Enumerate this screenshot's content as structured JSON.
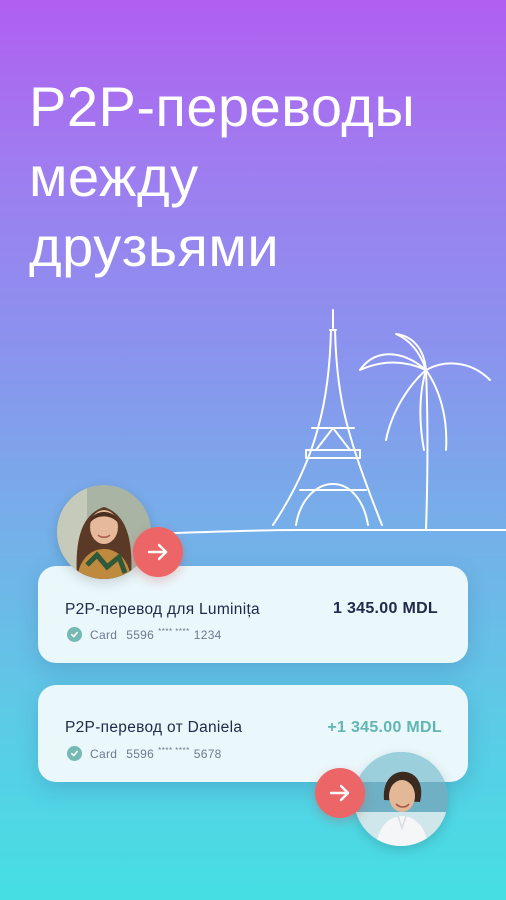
{
  "headline": {
    "line1": "P2P-переводы",
    "line2": "между",
    "line3": "друзьями"
  },
  "colors": {
    "gradient_top": "#b05ff0",
    "gradient_bottom": "#45dfe3",
    "card_background": "#eaf7fb",
    "arrow_button": "#ec6567",
    "incoming_amount": "#5fb6b2",
    "check": "#74b9b3"
  },
  "transfers": [
    {
      "title": "P2P-перевод для Luminița",
      "amount": "1 345.00 MDL",
      "card_label": "Card",
      "card_prefix": "5596",
      "card_mask": "**** ****",
      "card_suffix": "1234",
      "status_icon": "check-icon",
      "avatar_icon": "woman-avatar",
      "direction_icon": "arrow-right-icon"
    },
    {
      "title": "P2P-перевод от Daniela",
      "amount": "+1 345.00 MDL",
      "card_label": "Card",
      "card_prefix": "5596",
      "card_mask": "**** ****",
      "card_suffix": "5678",
      "status_icon": "check-icon",
      "avatar_icon": "woman-avatar",
      "direction_icon": "arrow-right-icon"
    }
  ]
}
